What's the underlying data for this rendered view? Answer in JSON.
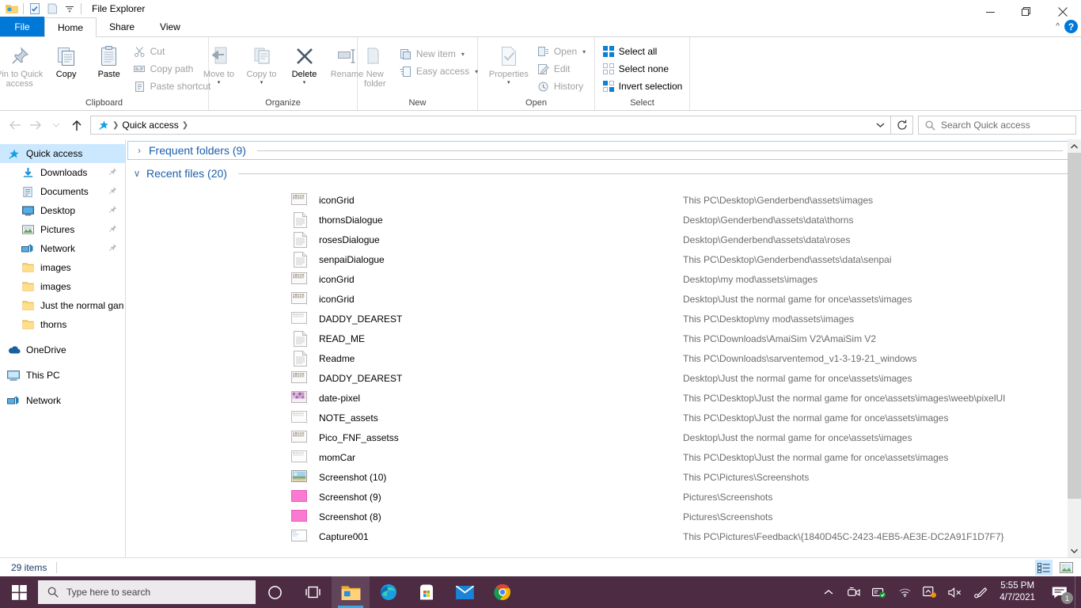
{
  "window": {
    "title": "File Explorer",
    "quick_access_toolbar": [
      {
        "name": "explorer-icon",
        "label": "File Explorer"
      },
      {
        "name": "properties-icon",
        "label": "Properties"
      },
      {
        "name": "new-folder-icon",
        "label": "New folder"
      },
      {
        "name": "customize-qat-icon",
        "label": "Customize Quick Access Toolbar"
      }
    ],
    "controls": {
      "minimize": "Minimize",
      "maximize": "Restore Down",
      "close": "Close"
    },
    "help_label": "?",
    "collapse_ribbon_label": "^"
  },
  "ribbon": {
    "tabs": [
      {
        "label": "File",
        "active": false,
        "is_file": true
      },
      {
        "label": "Home",
        "active": true,
        "is_file": false
      },
      {
        "label": "Share",
        "active": false,
        "is_file": false
      },
      {
        "label": "View",
        "active": false,
        "is_file": false
      }
    ],
    "groups": [
      {
        "label": "Clipboard",
        "big": [
          {
            "label": "Pin to Quick access",
            "icon": "pin-icon",
            "disabled": true,
            "caret": false
          },
          {
            "label": "Copy",
            "icon": "copy-icon",
            "disabled": false,
            "caret": false
          },
          {
            "label": "Paste",
            "icon": "paste-icon",
            "disabled": false,
            "caret": false
          }
        ],
        "small": [
          {
            "label": "Cut",
            "icon": "scissors-icon",
            "disabled": true,
            "caret": false
          },
          {
            "label": "Copy path",
            "icon": "copy-path-icon",
            "disabled": true,
            "caret": false
          },
          {
            "label": "Paste shortcut",
            "icon": "paste-shortcut-icon",
            "disabled": true,
            "caret": false
          }
        ]
      },
      {
        "label": "Organize",
        "big": [
          {
            "label": "Move to",
            "icon": "move-to-icon",
            "disabled": true,
            "caret": true
          },
          {
            "label": "Copy to",
            "icon": "copy-to-icon",
            "disabled": true,
            "caret": true
          },
          {
            "label": "Delete",
            "icon": "delete-icon",
            "disabled": false,
            "caret": true
          },
          {
            "label": "Rename",
            "icon": "rename-icon",
            "disabled": true,
            "caret": false
          }
        ],
        "small": []
      },
      {
        "label": "New",
        "big": [
          {
            "label": "New folder",
            "icon": "new-folder-icon",
            "disabled": true,
            "caret": false
          }
        ],
        "small": [
          {
            "label": "New item",
            "icon": "new-item-icon",
            "disabled": true,
            "caret": true
          },
          {
            "label": "Easy access",
            "icon": "easy-access-icon",
            "disabled": true,
            "caret": true
          }
        ]
      },
      {
        "label": "Open",
        "big": [
          {
            "label": "Properties",
            "icon": "properties-icon",
            "disabled": true,
            "caret": true
          }
        ],
        "small": [
          {
            "label": "Open",
            "icon": "open-icon",
            "disabled": true,
            "caret": true
          },
          {
            "label": "Edit",
            "icon": "edit-icon",
            "disabled": true,
            "caret": false
          },
          {
            "label": "History",
            "icon": "history-icon",
            "disabled": true,
            "caret": false
          }
        ]
      },
      {
        "label": "Select",
        "big": [],
        "small": [
          {
            "label": "Select all",
            "icon": "select-all-icon",
            "disabled": false,
            "caret": false
          },
          {
            "label": "Select none",
            "icon": "select-none-icon",
            "disabled": false,
            "caret": false
          },
          {
            "label": "Invert selection",
            "icon": "invert-selection-icon",
            "disabled": false,
            "caret": false
          }
        ]
      }
    ]
  },
  "addressbar": {
    "back_label": "Back",
    "forward_label": "Forward",
    "recent_label": "Recent locations",
    "up_label": "Up",
    "breadcrumb": [
      "Quick access"
    ],
    "breadcrumb_icon": "quick-access-star-icon",
    "dropdown_label": "Previous locations",
    "refresh_label": "Refresh",
    "search_placeholder": "Search Quick access",
    "search_value": ""
  },
  "navpane": {
    "items": [
      {
        "label": "Quick access",
        "icon": "quick-access-star-icon",
        "depth": 0,
        "selected": true,
        "pinned": false
      },
      {
        "label": "Downloads",
        "icon": "downloads-icon",
        "depth": 1,
        "selected": false,
        "pinned": true
      },
      {
        "label": "Documents",
        "icon": "documents-icon",
        "depth": 1,
        "selected": false,
        "pinned": true
      },
      {
        "label": "Desktop",
        "icon": "desktop-icon",
        "depth": 1,
        "selected": false,
        "pinned": true
      },
      {
        "label": "Pictures",
        "icon": "pictures-icon",
        "depth": 1,
        "selected": false,
        "pinned": true
      },
      {
        "label": "Network",
        "icon": "network-icon",
        "depth": 1,
        "selected": false,
        "pinned": true
      },
      {
        "label": "images",
        "icon": "folder-icon",
        "depth": 1,
        "selected": false,
        "pinned": false
      },
      {
        "label": "images",
        "icon": "folder-icon",
        "depth": 1,
        "selected": false,
        "pinned": false
      },
      {
        "label": "Just the normal gan",
        "icon": "folder-icon",
        "depth": 1,
        "selected": false,
        "pinned": false
      },
      {
        "label": "thorns",
        "icon": "folder-icon",
        "depth": 1,
        "selected": false,
        "pinned": false
      },
      {
        "label": "",
        "icon": "gap",
        "depth": 0,
        "selected": false,
        "pinned": false
      },
      {
        "label": "OneDrive",
        "icon": "onedrive-icon",
        "depth": 0,
        "selected": false,
        "pinned": false
      },
      {
        "label": "",
        "icon": "gap",
        "depth": 0,
        "selected": false,
        "pinned": false
      },
      {
        "label": "This PC",
        "icon": "this-pc-icon",
        "depth": 0,
        "selected": false,
        "pinned": false
      },
      {
        "label": "",
        "icon": "gap",
        "depth": 0,
        "selected": false,
        "pinned": false
      },
      {
        "label": "Network",
        "icon": "network-icon",
        "depth": 0,
        "selected": false,
        "pinned": false
      }
    ]
  },
  "content": {
    "groups": [
      {
        "label": "Frequent folders (9)",
        "expanded": false,
        "focused": true,
        "chevron": "›"
      },
      {
        "label": "Recent files (20)",
        "expanded": true,
        "focused": false,
        "chevron": "∨"
      }
    ],
    "files": [
      {
        "name": "iconGrid",
        "path": "This PC\\Desktop\\Genderbend\\assets\\images",
        "icon": "image-thumb-grid"
      },
      {
        "name": "thornsDialogue",
        "path": "Desktop\\Genderbend\\assets\\data\\thorns",
        "icon": "text-doc"
      },
      {
        "name": "rosesDialogue",
        "path": "Desktop\\Genderbend\\assets\\data\\roses",
        "icon": "text-doc"
      },
      {
        "name": "senpaiDialogue",
        "path": "This PC\\Desktop\\Genderbend\\assets\\data\\senpai",
        "icon": "text-doc"
      },
      {
        "name": "iconGrid",
        "path": "Desktop\\my mod\\assets\\images",
        "icon": "image-thumb-grid"
      },
      {
        "name": "iconGrid",
        "path": "Desktop\\Just the normal game for once\\assets\\images",
        "icon": "image-thumb-grid"
      },
      {
        "name": "DADDY_DEAREST",
        "path": "This PC\\Desktop\\my mod\\assets\\images",
        "icon": "image-thumb-faint"
      },
      {
        "name": "READ_ME",
        "path": "This PC\\Downloads\\AmaiSim V2\\AmaiSim V2",
        "icon": "text-doc"
      },
      {
        "name": "Readme",
        "path": "This PC\\Downloads\\sarventemod_v1-3-19-21_windows",
        "icon": "text-doc"
      },
      {
        "name": "DADDY_DEAREST",
        "path": "Desktop\\Just the normal game for once\\assets\\images",
        "icon": "image-thumb-grid"
      },
      {
        "name": "date-pixel",
        "path": "This PC\\Desktop\\Just the normal game for once\\assets\\images\\weeb\\pixelUI",
        "icon": "image-thumb-pixel"
      },
      {
        "name": "NOTE_assets",
        "path": "This PC\\Desktop\\Just the normal game for once\\assets\\images",
        "icon": "image-thumb-faint"
      },
      {
        "name": "Pico_FNF_assetss",
        "path": "Desktop\\Just the normal game for once\\assets\\images",
        "icon": "image-thumb-grid"
      },
      {
        "name": "momCar",
        "path": "This PC\\Desktop\\Just the normal game for once\\assets\\images",
        "icon": "image-thumb-faint"
      },
      {
        "name": "Screenshot (10)",
        "path": "This PC\\Pictures\\Screenshots",
        "icon": "image-thumb-photo"
      },
      {
        "name": "Screenshot (9)",
        "path": "Pictures\\Screenshots",
        "icon": "image-thumb-pink"
      },
      {
        "name": "Screenshot (8)",
        "path": "Pictures\\Screenshots",
        "icon": "image-thumb-pink"
      },
      {
        "name": "Capture001",
        "path": "This PC\\Pictures\\Feedback\\{1840D45C-2423-4EB5-AE3E-DC2A91F1D7F7}",
        "icon": "image-thumb-blue"
      }
    ]
  },
  "statusbar": {
    "item_count": "29 items",
    "views": [
      {
        "name": "details-view",
        "label": "Details view",
        "active": true
      },
      {
        "name": "large-icons-view",
        "label": "Large icons view",
        "active": false
      }
    ]
  },
  "taskbar": {
    "start_label": "Start",
    "search_placeholder": "Type here to search",
    "buttons": [
      {
        "name": "cortana-icon",
        "label": "Cortana",
        "running": false
      },
      {
        "name": "task-view-icon",
        "label": "Task View",
        "running": false
      },
      {
        "name": "file-explorer-icon",
        "label": "File Explorer",
        "running": true
      },
      {
        "name": "edge-icon",
        "label": "Microsoft Edge",
        "running": false
      },
      {
        "name": "store-icon",
        "label": "Microsoft Store",
        "running": false
      },
      {
        "name": "mail-icon",
        "label": "Mail",
        "running": false
      },
      {
        "name": "chrome-icon",
        "label": "Google Chrome",
        "running": false
      }
    ],
    "tray": [
      {
        "name": "show-hidden-icons-icon",
        "label": "Show hidden icons"
      },
      {
        "name": "camera-icon",
        "label": "Camera"
      },
      {
        "name": "antivirus-icon",
        "label": "Security"
      },
      {
        "name": "wifi-icon",
        "label": "Network"
      },
      {
        "name": "onedrive-sync-icon",
        "label": "OneDrive"
      },
      {
        "name": "volume-muted-icon",
        "label": "Volume muted"
      },
      {
        "name": "pen-icon",
        "label": "Pen"
      }
    ],
    "clock": {
      "time": "5:55 PM",
      "date": "4/7/2021"
    },
    "notifications": {
      "count": "1",
      "label": "Notifications"
    }
  },
  "colors": {
    "accent": "#0078d7",
    "taskbar": "#4c2b43",
    "selection": "#cce8ff",
    "group_header": "#1b5eab",
    "path_text": "#6c6c6c",
    "close_hover": "#e81123"
  }
}
